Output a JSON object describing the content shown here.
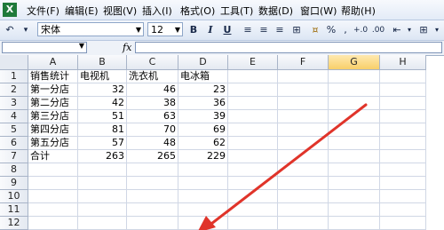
{
  "menu": {
    "items": [
      "文件(F)",
      "编辑(E)",
      "视图(V)",
      "插入(I)",
      "格式(O)",
      "工具(T)",
      "数据(D)",
      "窗口(W)",
      "帮助(H)"
    ]
  },
  "toolbar": {
    "font_name": "宋体",
    "font_size": "12",
    "bold": "B",
    "italic": "I",
    "underline": "U",
    "percent": "%",
    "comma": ","
  },
  "formula_bar": {
    "fx": "fx",
    "name_box": "",
    "formula": ""
  },
  "sheet": {
    "columns": [
      "A",
      "B",
      "C",
      "D",
      "E",
      "F",
      "G",
      "H"
    ],
    "selected_column": "G",
    "rows": [
      "1",
      "2",
      "3",
      "4",
      "5",
      "6",
      "7",
      "8",
      "9",
      "10",
      "11",
      "12"
    ],
    "data": [
      [
        "销售统计",
        "电视机",
        "洗衣机",
        "电冰箱"
      ],
      [
        "第一分店",
        "32",
        "46",
        "23"
      ],
      [
        "第二分店",
        "42",
        "38",
        "36"
      ],
      [
        "第三分店",
        "51",
        "63",
        "39"
      ],
      [
        "第四分店",
        "81",
        "70",
        "69"
      ],
      [
        "第五分店",
        "57",
        "48",
        "62"
      ],
      [
        "合计",
        "263",
        "265",
        "229"
      ]
    ]
  },
  "colors": {
    "annotation_arrow": "#e0342a"
  }
}
